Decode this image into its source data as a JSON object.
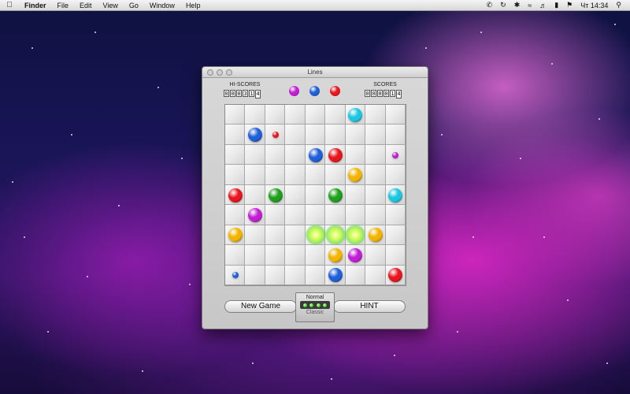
{
  "menubar": {
    "app": "Finder",
    "items": [
      "File",
      "Edit",
      "View",
      "Go",
      "Window",
      "Help"
    ],
    "clock": "Чт 14:34"
  },
  "window": {
    "title": "Lines"
  },
  "scores": {
    "hi_label": "HI-SCORES",
    "hi_digits": [
      "0",
      "0",
      "0",
      "3",
      "1",
      "4"
    ],
    "score_label": "SCORES",
    "score_digits": [
      "0",
      "0",
      "0",
      "0",
      "1",
      "4"
    ]
  },
  "next_balls": [
    "magenta",
    "blue",
    "red"
  ],
  "board": {
    "size": 9,
    "balls": [
      {
        "row": 0,
        "col": 6,
        "color": "cyan",
        "size": "big"
      },
      {
        "row": 1,
        "col": 1,
        "color": "blue",
        "size": "big"
      },
      {
        "row": 1,
        "col": 2,
        "color": "red",
        "size": "small"
      },
      {
        "row": 2,
        "col": 4,
        "color": "blue",
        "size": "big"
      },
      {
        "row": 2,
        "col": 5,
        "color": "red",
        "size": "big"
      },
      {
        "row": 2,
        "col": 8,
        "color": "magenta",
        "size": "small"
      },
      {
        "row": 3,
        "col": 6,
        "color": "yellow",
        "size": "big"
      },
      {
        "row": 4,
        "col": 0,
        "color": "red",
        "size": "big"
      },
      {
        "row": 4,
        "col": 2,
        "color": "green",
        "size": "big"
      },
      {
        "row": 4,
        "col": 5,
        "color": "green",
        "size": "big"
      },
      {
        "row": 4,
        "col": 8,
        "color": "cyan",
        "size": "big"
      },
      {
        "row": 5,
        "col": 1,
        "color": "magenta",
        "size": "big"
      },
      {
        "row": 6,
        "col": 0,
        "color": "yellow",
        "size": "big"
      },
      {
        "row": 6,
        "col": 4,
        "color": "green",
        "size": "exploding"
      },
      {
        "row": 6,
        "col": 5,
        "color": "green",
        "size": "exploding"
      },
      {
        "row": 6,
        "col": 6,
        "color": "green",
        "size": "exploding"
      },
      {
        "row": 6,
        "col": 7,
        "color": "yellow",
        "size": "big"
      },
      {
        "row": 7,
        "col": 5,
        "color": "yellow",
        "size": "big"
      },
      {
        "row": 7,
        "col": 6,
        "color": "magenta",
        "size": "big"
      },
      {
        "row": 8,
        "col": 0,
        "color": "blue",
        "size": "small"
      },
      {
        "row": 8,
        "col": 5,
        "color": "blue",
        "size": "big"
      },
      {
        "row": 8,
        "col": 8,
        "color": "red",
        "size": "big"
      }
    ]
  },
  "colors": {
    "red": "#e8161e",
    "blue": "#1f5fd8",
    "green": "#1fa01c",
    "yellow": "#f2b400",
    "cyan": "#1cc6e0",
    "magenta": "#c21ed4"
  },
  "controls": {
    "new_game": "New Game",
    "hint": "HINT",
    "mode_top": "Normal",
    "mode_bottom": "Classic"
  }
}
